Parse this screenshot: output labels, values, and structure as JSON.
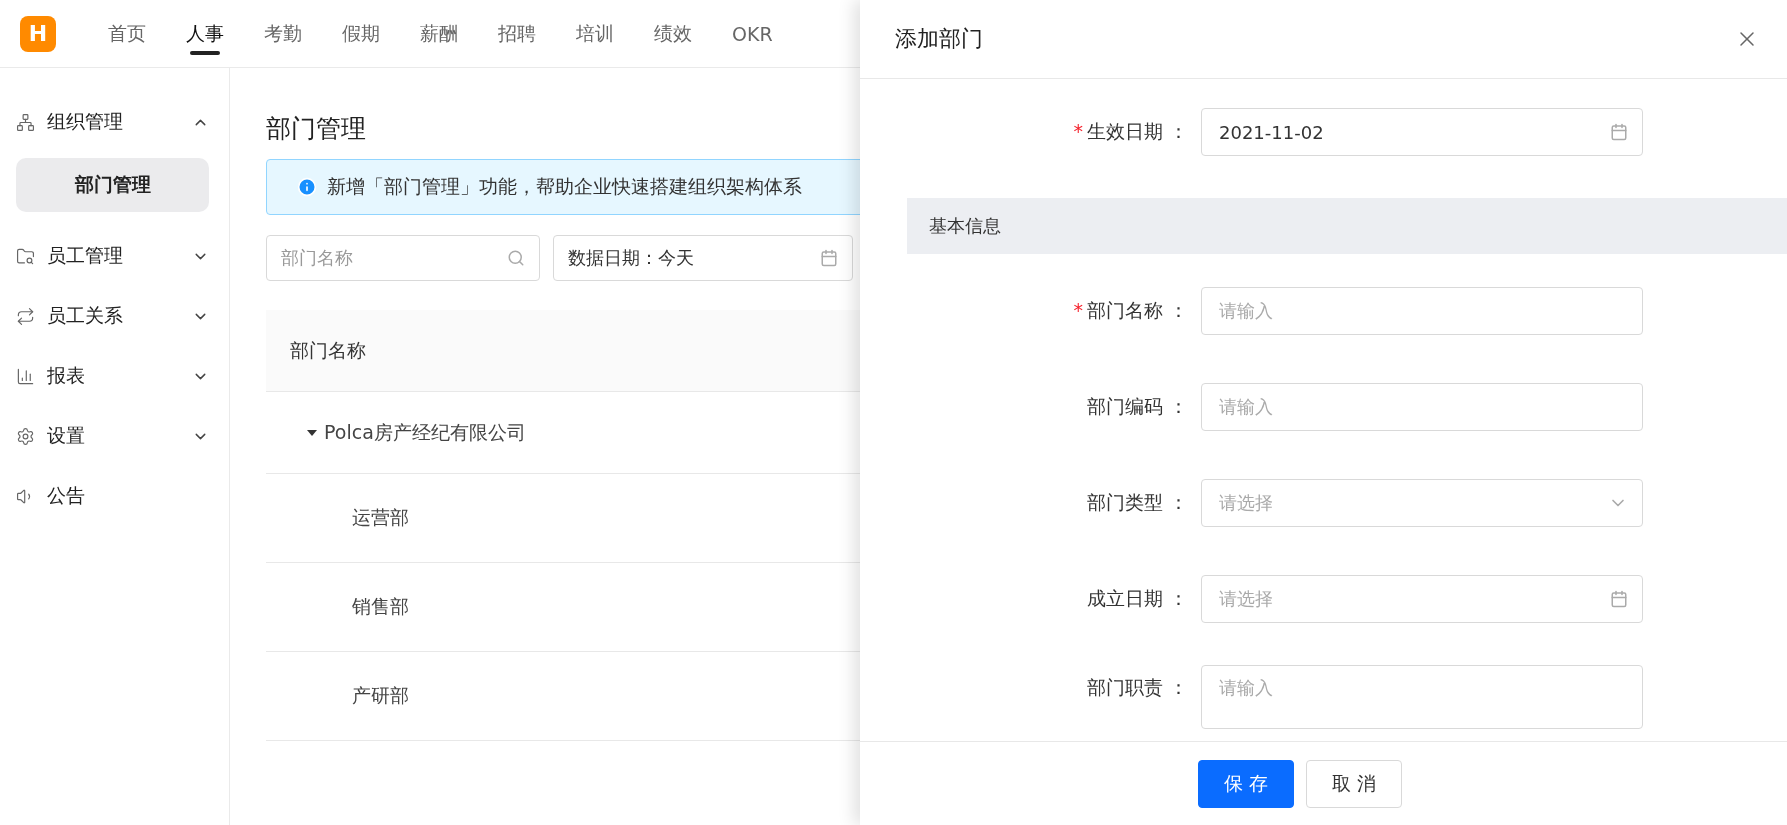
{
  "top_nav": {
    "logo": "H",
    "tabs": [
      {
        "label": "首页",
        "selected": false
      },
      {
        "label": "人事",
        "selected": true
      },
      {
        "label": "考勤",
        "selected": false
      },
      {
        "label": "假期",
        "selected": false
      },
      {
        "label": "薪酬",
        "selected": false
      },
      {
        "label": "招聘",
        "selected": false
      },
      {
        "label": "培训",
        "selected": false
      },
      {
        "label": "绩效",
        "selected": false
      },
      {
        "label": "OKR",
        "selected": false
      }
    ]
  },
  "sidebar": {
    "items": [
      {
        "label": "组织管理",
        "kind": "group",
        "expanded": true,
        "children": [
          {
            "label": "部门管理",
            "selected": true
          }
        ]
      },
      {
        "label": "员工管理",
        "kind": "group",
        "expanded": false
      },
      {
        "label": "员工关系",
        "kind": "group",
        "expanded": false
      },
      {
        "label": "报表",
        "kind": "group",
        "expanded": false
      },
      {
        "label": "设置",
        "kind": "group",
        "expanded": false
      },
      {
        "label": "公告",
        "kind": "link"
      }
    ]
  },
  "main": {
    "title": "部门管理",
    "alert": "新增「部门管理」功能，帮助企业快速搭建组织架构体系",
    "search": {
      "placeholder": "部门名称"
    },
    "date_filter": {
      "value": "数据日期：今天"
    },
    "table": {
      "columns": [
        "部门名称"
      ],
      "rows": [
        {
          "name": "Polca房产经纪有限公司",
          "expanded": true,
          "children": [
            {
              "name": "运营部"
            },
            {
              "name": "销售部"
            },
            {
              "name": "产研部"
            }
          ]
        }
      ]
    }
  },
  "drawer": {
    "title": "添加部门",
    "top_fields": [
      {
        "label": "生效日期 ：",
        "kind": "date",
        "required_mark": "*",
        "value": "2021-11-02"
      }
    ],
    "section": "基本信息",
    "fields": [
      {
        "label": "部门名称 ：",
        "kind": "text",
        "required_mark": "*",
        "placeholder": "请输入"
      },
      {
        "label": "部门编码 ：",
        "kind": "text",
        "placeholder": "请输入"
      },
      {
        "label": "部门类型 ：",
        "kind": "select",
        "placeholder": "请选择"
      },
      {
        "label": "成立日期 ：",
        "kind": "date",
        "placeholder": "请选择"
      },
      {
        "label": "部门职责 ：",
        "kind": "textarea",
        "placeholder": "请输入"
      }
    ],
    "buttons": [
      {
        "label": "保 存",
        "kind": "primary"
      },
      {
        "label": "取 消",
        "kind": "default"
      }
    ]
  }
}
